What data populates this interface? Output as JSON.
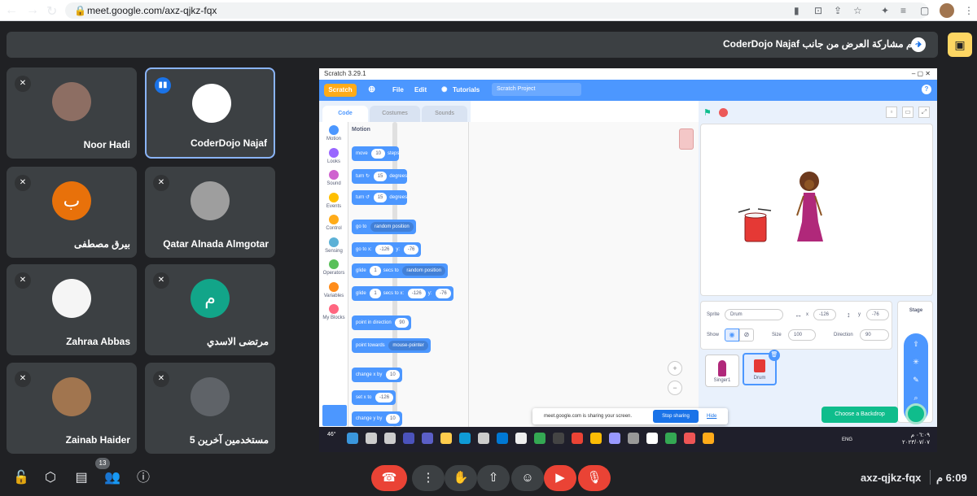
{
  "browser": {
    "url": "meet.google.com/axz-qjkz-fqx"
  },
  "banner": {
    "text": "تتم مشاركة العرض من جانب CoderDojo Najaf"
  },
  "participants": [
    {
      "name": "Noor Hadi",
      "initial": "",
      "avatar_color": "#8d6e63",
      "speaking": false,
      "active": false
    },
    {
      "name": "CoderDojo Najaf",
      "initial": "",
      "avatar_color": "#ffffff",
      "speaking": true,
      "active": true
    },
    {
      "name": "بيرق مصطفى",
      "initial": "ب",
      "avatar_color": "#e8710a",
      "speaking": false,
      "active": false
    },
    {
      "name": "Qatar Alnada Almgotar",
      "initial": "",
      "avatar_color": "#9e9e9e",
      "speaking": false,
      "active": false
    },
    {
      "name": "Zahraa Abbas",
      "initial": "",
      "avatar_color": "#f5f5f5",
      "speaking": false,
      "active": false
    },
    {
      "name": "مرتضى الاسدي",
      "initial": "م",
      "avatar_color": "#12a589",
      "speaking": false,
      "active": false
    },
    {
      "name": "Zainab Haider",
      "initial": "",
      "avatar_color": "#a1754f",
      "speaking": false,
      "active": false
    },
    {
      "name": "5 مستخدمين آخرين",
      "initial": "",
      "avatar_color": "#5f6368",
      "speaking": false,
      "active": false
    }
  ],
  "scratch": {
    "window_title": "Scratch 3.29.1",
    "logo": "Scratch",
    "menu": {
      "file": "File",
      "edit": "Edit",
      "tutorials": "Tutorials"
    },
    "project_title": "Scratch Project",
    "tabs": {
      "code": "Code",
      "costumes": "Costumes",
      "sounds": "Sounds"
    },
    "categories": [
      {
        "label": "Motion",
        "color": "#4c97ff"
      },
      {
        "label": "Looks",
        "color": "#9966ff"
      },
      {
        "label": "Sound",
        "color": "#cf63cf"
      },
      {
        "label": "Events",
        "color": "#ffbf00"
      },
      {
        "label": "Control",
        "color": "#ffab19"
      },
      {
        "label": "Sensing",
        "color": "#5cb1d6"
      },
      {
        "label": "Operators",
        "color": "#59c059"
      },
      {
        "label": "Variables",
        "color": "#ff8c1a"
      },
      {
        "label": "My Blocks",
        "color": "#ff6680"
      }
    ],
    "palette_heading": "Motion",
    "blocks": {
      "move": "move",
      "move_val": "10",
      "steps": "steps",
      "turn": "turn",
      "turn_val": "15",
      "degrees": "degrees",
      "goto": "go to",
      "random_position": "random position",
      "goto_x": "go to x:",
      "x_val": "-126",
      "y_label": "y:",
      "y_val": "-76",
      "glide": "glide",
      "glide_val": "1",
      "secs_to": "secs to",
      "secs_to_x": "secs to x:",
      "point_dir": "point in direction",
      "dir_val": "90",
      "point_towards": "point towards",
      "mouse_pointer": "mouse-pointer",
      "change_x": "change x by",
      "change_val": "10",
      "set_x": "set x to",
      "change_y": "change y by"
    },
    "sprite_info": {
      "sprite_label": "Sprite",
      "sprite_name": "Drum",
      "x_label": "x",
      "x": "-126",
      "y_label": "y",
      "y": "-76",
      "show_label": "Show",
      "size_label": "Size",
      "size": "100",
      "direction_label": "Direction",
      "direction": "90"
    },
    "sprites": [
      {
        "name": "Singer1",
        "selected": false
      },
      {
        "name": "Drum",
        "selected": true
      }
    ],
    "stage_label": "Stage",
    "choose_backdrop": "Choose a Backdrop",
    "share_notice": {
      "text": "meet.google.com is sharing your screen.",
      "stop": "Stop sharing",
      "hide": "Hide"
    },
    "taskbar": {
      "weather": "46°",
      "lang": "ENG",
      "time": "٠٦:٠٩ م",
      "date": "٢٠٢٣/٠٧/٠٧"
    }
  },
  "bottom": {
    "chat_count": "13",
    "meeting_code": "axz-qjkz-fqx",
    "clock": "6:09 م"
  }
}
